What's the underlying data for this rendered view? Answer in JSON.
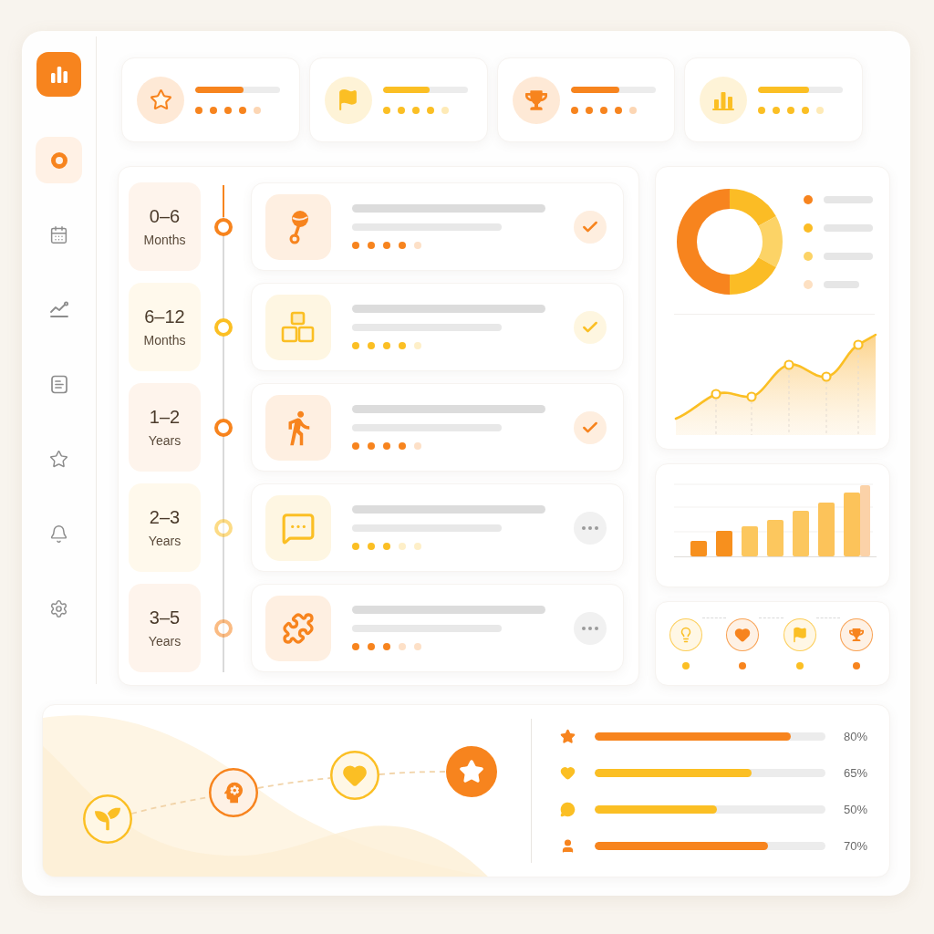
{
  "sidebar": {
    "items": [
      {
        "selected": true
      },
      {
        "selected": false
      },
      {
        "selected": false
      },
      {
        "selected": false
      },
      {
        "selected": false
      },
      {
        "selected": false
      },
      {
        "selected": false
      }
    ]
  },
  "stat_cards": [
    {
      "color": "#f7841e",
      "level": 0.57,
      "stars": 4
    },
    {
      "color": "#fbbf24",
      "level": 0.55,
      "stars": 4
    },
    {
      "color": "#f7841e",
      "level": 0.58,
      "stars": 4
    },
    {
      "color": "#fbbf24",
      "level": 0.6,
      "stars": 4
    }
  ],
  "timeline": {
    "stages": [
      {
        "range": "0–6",
        "unit": "Months",
        "color": "#f7841e",
        "stars": 4,
        "completed": true
      },
      {
        "range": "6–12",
        "unit": "Months",
        "color": "#fbbf24",
        "stars": 4,
        "completed": true
      },
      {
        "range": "1–2",
        "unit": "Years",
        "color": "#f7841e",
        "stars": 4,
        "completed": true
      },
      {
        "range": "2–3",
        "unit": "Years",
        "color": "#fbbf24",
        "stars": 3,
        "completed": false
      },
      {
        "range": "3–5",
        "unit": "Years",
        "color": "#f7841e",
        "stars": 3,
        "completed": false
      }
    ]
  },
  "insights": {
    "legend": [
      {
        "color": "#f7841e"
      },
      {
        "color": "#fbbc25"
      },
      {
        "color": "#fcd366"
      },
      {
        "color": "#fde0c2"
      }
    ]
  },
  "badges": [
    {
      "color": "#fbbf24"
    },
    {
      "color": "#f7841e"
    },
    {
      "color": "#fbbf24"
    },
    {
      "color": "#f7841e"
    }
  ],
  "journey": {
    "steps": [
      {
        "color": "#fbbf24",
        "current": false
      },
      {
        "color": "#f7841e",
        "current": false
      },
      {
        "color": "#fbbf24",
        "current": false
      },
      {
        "color": "#f7841e",
        "current": true
      }
    ]
  },
  "progress": [
    {
      "color": "#f7841e",
      "level": 0.85,
      "reading": "80%"
    },
    {
      "color": "#fbbf24",
      "level": 0.68,
      "reading": "65%"
    },
    {
      "color": "#fbbf24",
      "level": 0.53,
      "reading": "50%"
    },
    {
      "color": "#f7841e",
      "level": 0.75,
      "reading": "70%"
    }
  ]
}
